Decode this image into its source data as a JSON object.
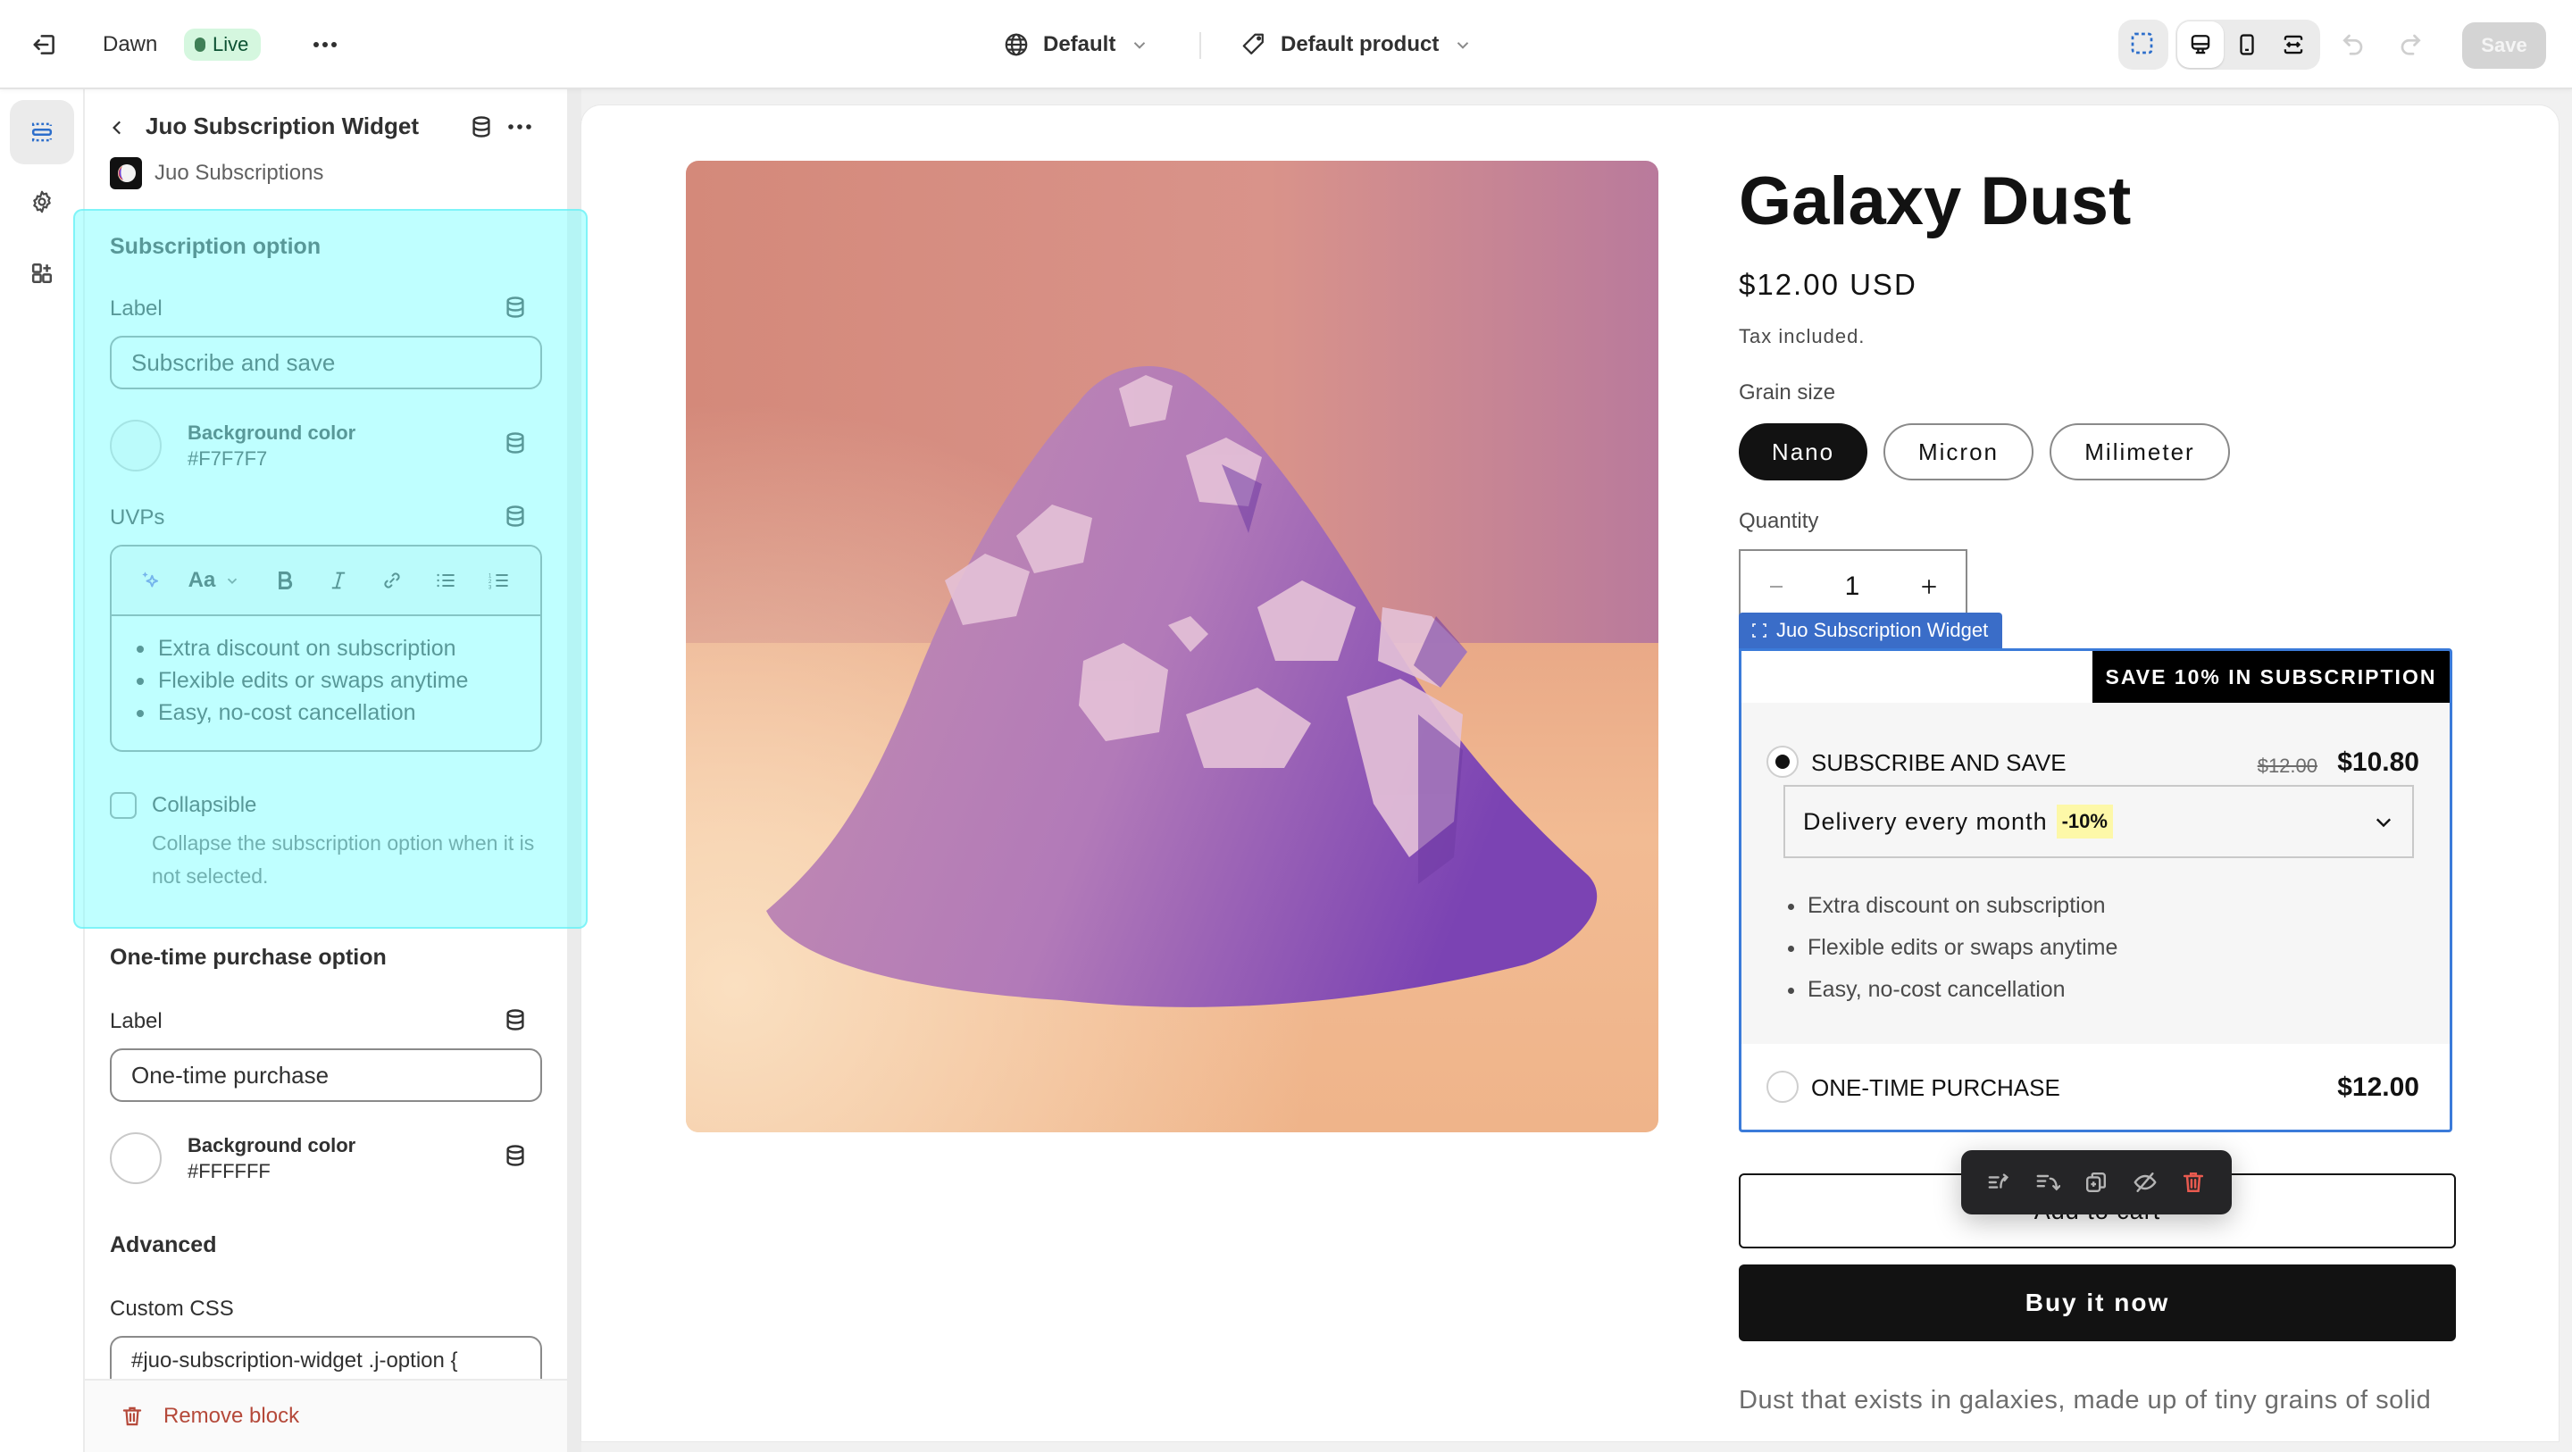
{
  "topbar": {
    "exit_icon": "exit-icon",
    "theme_name": "Dawn",
    "status_badge": "Live",
    "more_icon": "more-horizontal-icon",
    "locale_select": {
      "icon": "globe-icon",
      "value": "Default"
    },
    "template_select": {
      "icon": "tag-icon",
      "value": "Default product"
    },
    "tools": {
      "inspector": "select-cursor-icon",
      "viewports": [
        "desktop-icon",
        "mobile-icon",
        "fullwidth-icon"
      ],
      "active_viewport": "desktop"
    },
    "undo_icon": "undo-icon",
    "redo_icon": "redo-icon",
    "save_label": "Save"
  },
  "rail": {
    "items": [
      {
        "name": "sections",
        "icon": "sections-icon",
        "active": true
      },
      {
        "name": "settings",
        "icon": "gear-icon",
        "active": false
      },
      {
        "name": "apps",
        "icon": "apps-add-icon",
        "active": false
      }
    ]
  },
  "panel": {
    "title": "Juo Subscription Widget",
    "app_name": "Juo Subscriptions",
    "subscription_section": {
      "title": "Subscription option",
      "label_field": {
        "label": "Label",
        "value": "Subscribe and save"
      },
      "background": {
        "title": "Background color",
        "value": "#F7F7F7"
      },
      "uvps": {
        "label": "UVPs",
        "toolbar": [
          "ai-sparkle-icon",
          "text-style-icon",
          "bold-icon",
          "italic-icon",
          "link-icon",
          "bullet-list-icon",
          "numbered-list-icon"
        ],
        "text_style_label": "Aa",
        "items": [
          "Extra discount on subscription",
          "Flexible edits or swaps anytime",
          "Easy, no-cost cancellation"
        ]
      },
      "collapsible": {
        "label": "Collapsible",
        "checked": false,
        "help": "Collapse the subscription option when it is not selected."
      }
    },
    "onetime_section": {
      "title": "One-time purchase option",
      "label_field": {
        "label": "Label",
        "value": "One-time purchase"
      },
      "background": {
        "title": "Background color",
        "value": "#FFFFFF"
      }
    },
    "advanced_section": {
      "title": "Advanced",
      "custom_css_label": "Custom CSS",
      "custom_css_value": "#juo-subscription-widget .j-option {"
    },
    "remove_label": "Remove block"
  },
  "preview": {
    "product": {
      "name": "Galaxy Dust",
      "price": "$12.00 USD",
      "tax_note": "Tax included.",
      "grain_label": "Grain size",
      "grain_options": [
        "Nano",
        "Micron",
        "Milimeter"
      ],
      "grain_selected": "Nano",
      "quantity_label": "Quantity",
      "quantity": "1",
      "description": "Dust that exists in galaxies, made up of tiny grains of solid"
    },
    "widget": {
      "tag_label": "Juo Subscription Widget",
      "badge": "SAVE 10% IN SUBSCRIPTION",
      "subscribe": {
        "label": "SUBSCRIBE AND SAVE",
        "compare_price": "$12.00",
        "price": "$10.80",
        "selected": true,
        "delivery": "Delivery every month",
        "discount": "-10%",
        "uvps": [
          "Extra discount on subscription",
          "Flexible edits or swaps anytime",
          "Easy, no-cost cancellation"
        ]
      },
      "onetime": {
        "label": "ONE-TIME PURCHASE",
        "price": "$12.00",
        "selected": false
      }
    },
    "add_to_cart": "Add to cart",
    "buy_now": "Buy it now",
    "block_toolbar": [
      "move-up-icon",
      "move-down-icon",
      "duplicate-icon",
      "hide-icon",
      "delete-icon"
    ]
  },
  "colors": {
    "accent_blue": "#2c6ecb",
    "selection_highlight": "#80ffff",
    "live_badge_bg": "#d5f7df",
    "danger": "#e51c00",
    "discount_highlight": "#fdf8a8"
  }
}
